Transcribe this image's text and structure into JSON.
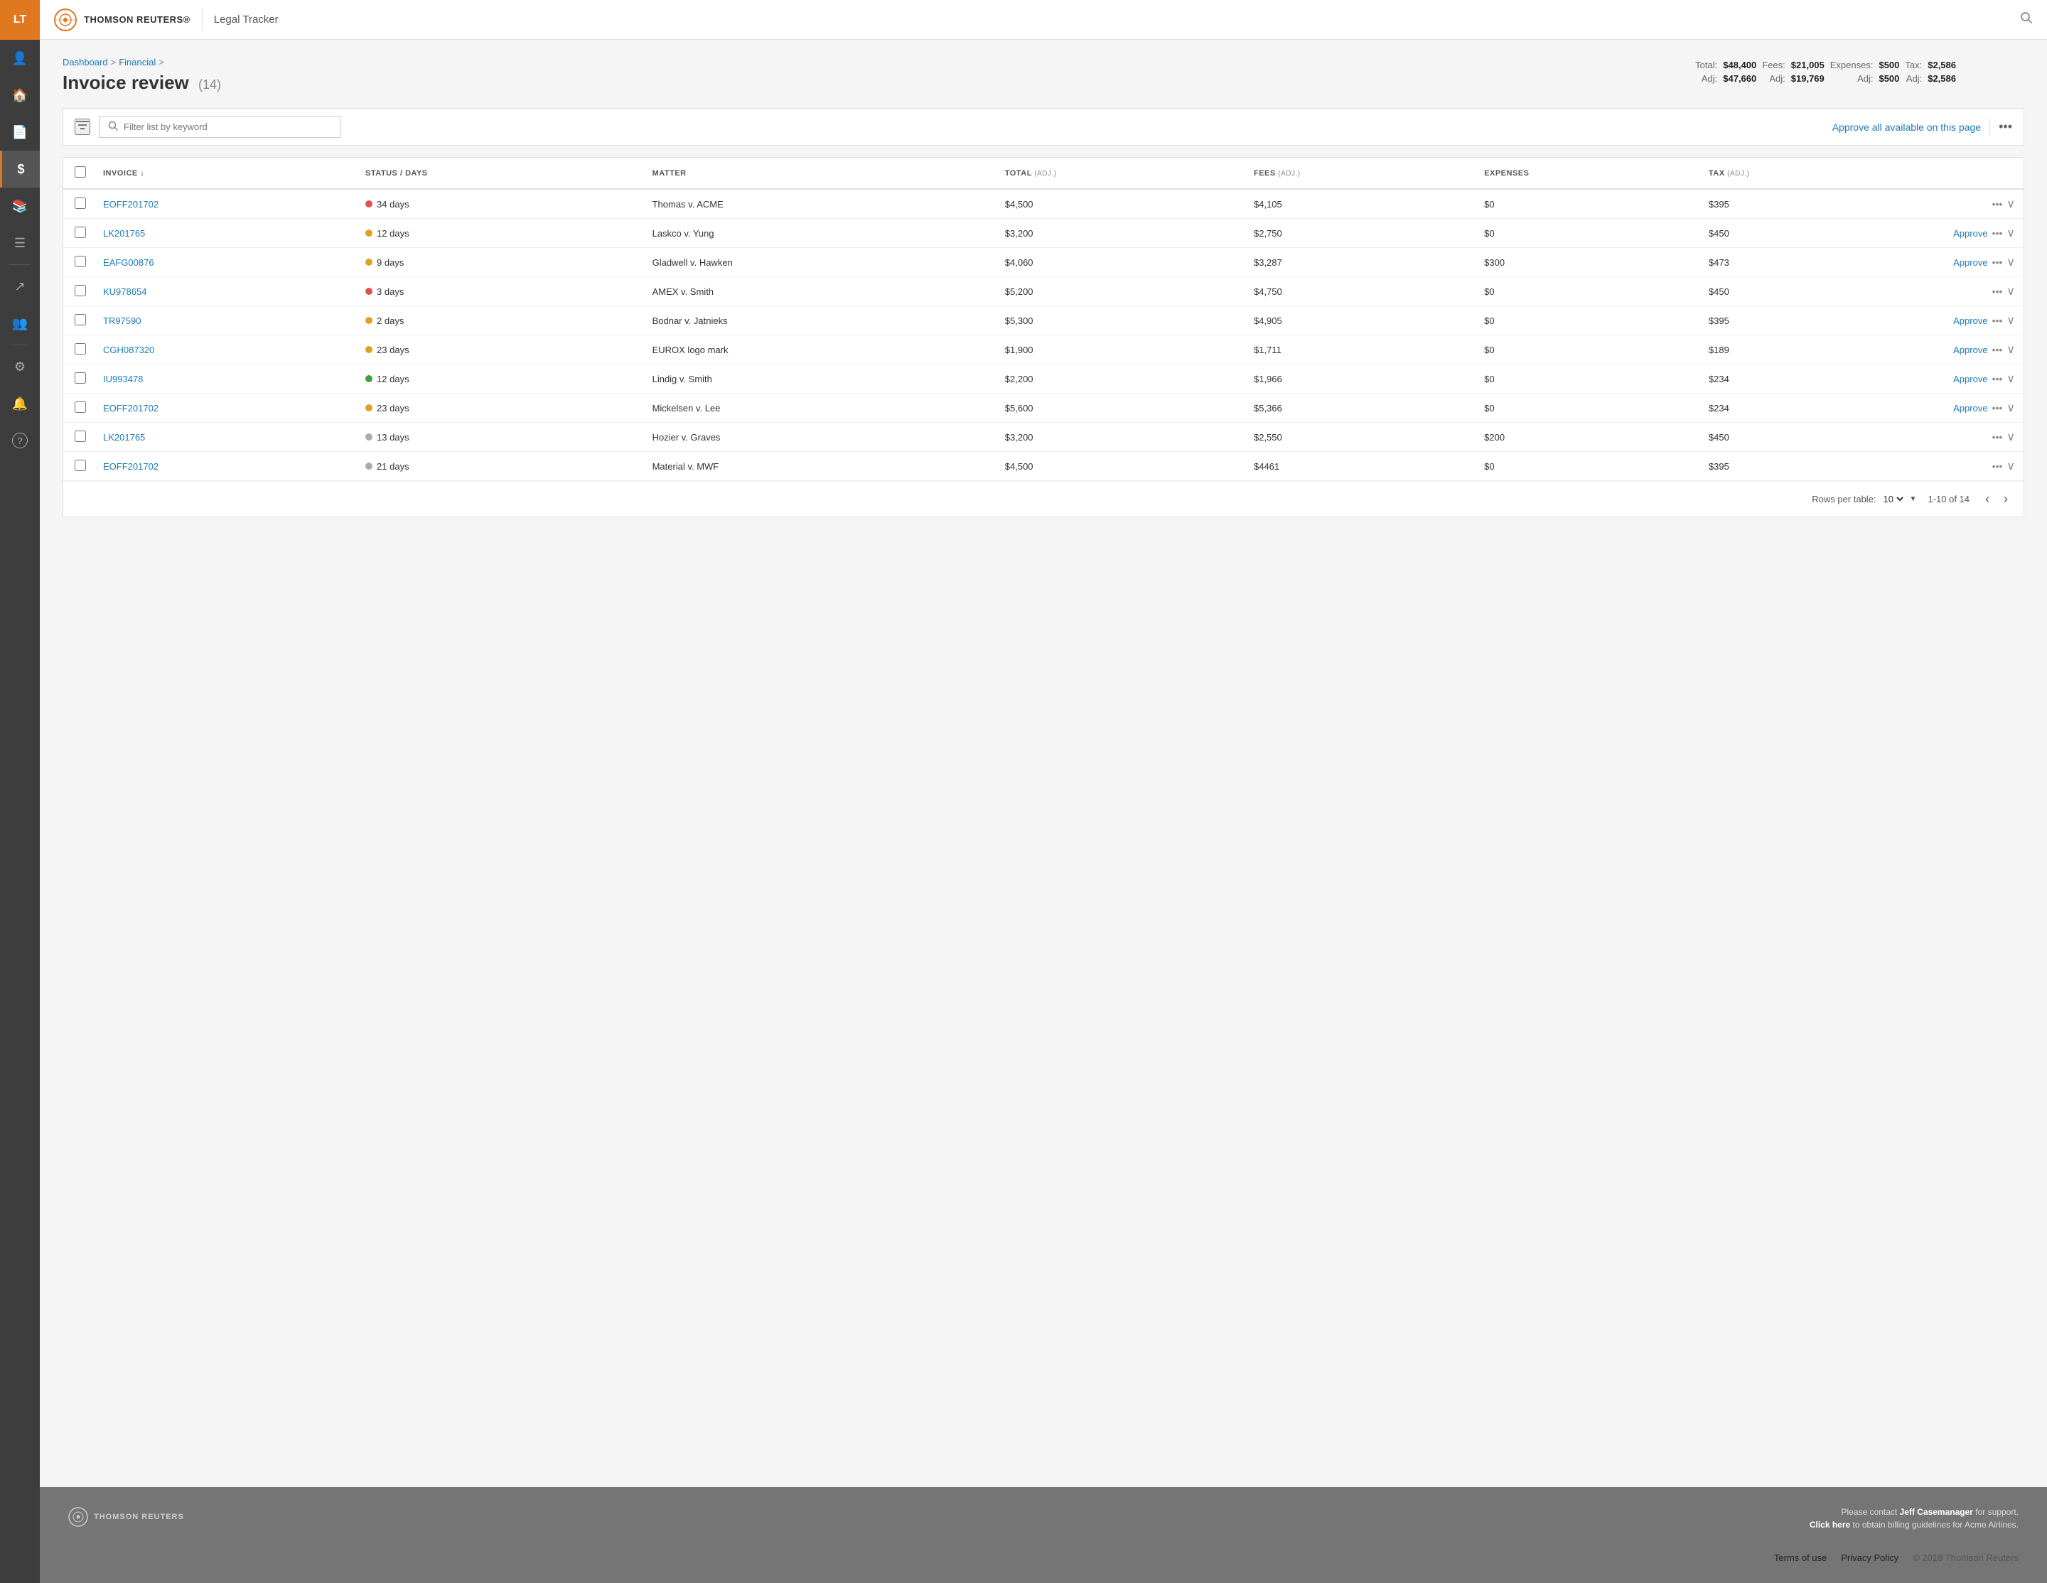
{
  "app": {
    "abbr": "LT",
    "brand": "THOMSON REUTERS®",
    "product": "Legal Tracker"
  },
  "sidebar": {
    "items": [
      {
        "id": "user",
        "icon": "👤",
        "active": false
      },
      {
        "id": "home",
        "icon": "🏠",
        "active": false
      },
      {
        "id": "document",
        "icon": "📄",
        "active": false
      },
      {
        "id": "dollar",
        "icon": "$",
        "active": true
      },
      {
        "id": "books",
        "icon": "📚",
        "active": false
      },
      {
        "id": "list",
        "icon": "☰",
        "active": false
      },
      {
        "id": "trend",
        "icon": "↗",
        "active": false
      },
      {
        "id": "people",
        "icon": "👥",
        "active": false
      },
      {
        "id": "gear",
        "icon": "⚙",
        "active": false
      },
      {
        "id": "bell",
        "icon": "🔔",
        "active": false
      },
      {
        "id": "help",
        "icon": "?",
        "active": false
      }
    ]
  },
  "breadcrumb": {
    "items": [
      "Dashboard",
      "Financial"
    ],
    "separators": [
      ">",
      ">"
    ],
    "current": ""
  },
  "page": {
    "title": "Invoice review",
    "count": "(14)"
  },
  "stats": {
    "total_label": "Total:",
    "total_value": "$48,400",
    "fees_label": "Fees:",
    "fees_value": "$21,005",
    "expenses_label": "Expenses:",
    "expenses_value": "$500",
    "tax_label": "Tax:",
    "tax_value": "$2,586",
    "adj_label": "Adj:",
    "adj_total": "$47,660",
    "adj_fees": "$19,769",
    "adj_expenses": "$500",
    "adj_tax": "$2,586"
  },
  "toolbar": {
    "search_placeholder": "Filter list by keyword",
    "approve_all_label": "Approve all available on this page"
  },
  "table": {
    "columns": [
      {
        "id": "invoice",
        "label": "INVOICE ↓"
      },
      {
        "id": "status",
        "label": "STATUS / DAYS"
      },
      {
        "id": "matter",
        "label": "MATTER"
      },
      {
        "id": "total",
        "label": "TOTAL (ADJ.)"
      },
      {
        "id": "fees",
        "label": "FEES (ADJ.)"
      },
      {
        "id": "expenses",
        "label": "EXPENSES"
      },
      {
        "id": "tax",
        "label": "TAX (ADJ.)"
      }
    ],
    "rows": [
      {
        "invoice": "EOFF201702",
        "dot": "red",
        "days": "34 days",
        "matter": "Thomas v. ACME",
        "total": "$4,500",
        "fees": "$4,105",
        "expenses": "$0",
        "tax": "$395",
        "has_approve": false
      },
      {
        "invoice": "LK201765",
        "dot": "yellow",
        "days": "12 days",
        "matter": "Laskco v. Yung",
        "total": "$3,200",
        "fees": "$2,750",
        "expenses": "$0",
        "tax": "$450",
        "has_approve": true
      },
      {
        "invoice": "EAFG00876",
        "dot": "yellow",
        "days": "9 days",
        "matter": "Gladwell v. Hawken",
        "total": "$4,060",
        "fees": "$3,287",
        "expenses": "$300",
        "tax": "$473",
        "has_approve": true
      },
      {
        "invoice": "KU978654",
        "dot": "red",
        "days": "3 days",
        "matter": "AMEX v. Smith",
        "total": "$5,200",
        "fees": "$4,750",
        "expenses": "$0",
        "tax": "$450",
        "has_approve": false
      },
      {
        "invoice": "TR97590",
        "dot": "yellow",
        "days": "2 days",
        "matter": "Bodnar v. Jatnieks",
        "total": "$5,300",
        "fees": "$4,905",
        "expenses": "$0",
        "tax": "$395",
        "has_approve": true
      },
      {
        "invoice": "CGH087320",
        "dot": "yellow",
        "days": "23 days",
        "matter": "EUROX logo mark",
        "total": "$1,900",
        "fees": "$1,711",
        "expenses": "$0",
        "tax": "$189",
        "has_approve": true
      },
      {
        "invoice": "IU993478",
        "dot": "green",
        "days": "12 days",
        "matter": "Lindig v. Smith",
        "total": "$2,200",
        "fees": "$1,966",
        "expenses": "$0",
        "tax": "$234",
        "has_approve": true
      },
      {
        "invoice": "EOFF201702",
        "dot": "yellow",
        "days": "23 days",
        "matter": "Mickelsen v. Lee",
        "total": "$5,600",
        "fees": "$5,366",
        "expenses": "$0",
        "tax": "$234",
        "has_approve": true
      },
      {
        "invoice": "LK201765",
        "dot": "gray",
        "days": "13 days",
        "matter": "Hozier v. Graves",
        "total": "$3,200",
        "fees": "$2,550",
        "expenses": "$200",
        "tax": "$450",
        "has_approve": false
      },
      {
        "invoice": "EOFF201702",
        "dot": "gray",
        "days": "21 days",
        "matter": "Material v. MWF",
        "total": "$4,500",
        "fees": "$4461",
        "expenses": "$0",
        "tax": "$395",
        "has_approve": false
      }
    ]
  },
  "pagination": {
    "rows_per_table_label": "Rows per table:",
    "rows_per_table_value": "10",
    "page_info": "1-10 of 14"
  },
  "footer": {
    "support_text": "Please contact",
    "support_name": "Jeff Casemanager",
    "support_suffix": "for support.",
    "billing_prefix": "Click here",
    "billing_suffix": "to obtain billing guidelines for Acme Airlines.",
    "terms_label": "Terms of use",
    "privacy_label": "Privacy Policy",
    "copyright": "© 2018 Thomson Reuters",
    "brand": "THOMSON REUTERS"
  }
}
